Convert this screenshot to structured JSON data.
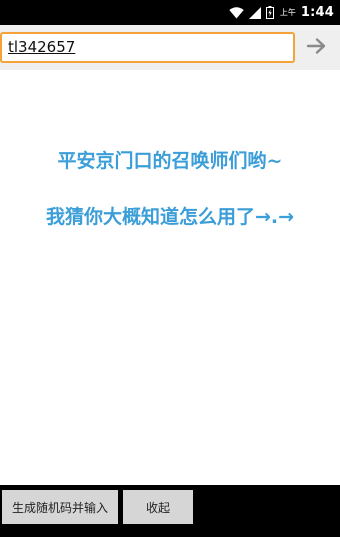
{
  "status_bar": {
    "carrier_text": "上午",
    "time": "1:44",
    "icons": [
      "wifi-icon",
      "signal-icon",
      "battery-icon"
    ]
  },
  "url_bar": {
    "value": "tl342657",
    "go_icon": "arrow-right-icon",
    "accent": "#f5a338"
  },
  "content": {
    "line1": "平安京门口的召唤师们哟~",
    "line2": "我猜你大概知道怎么用了→.→",
    "text_color": "#3b9ed8"
  },
  "bottom_bar": {
    "generate_button": "生成随机码并输入",
    "collapse_button": "收起"
  }
}
